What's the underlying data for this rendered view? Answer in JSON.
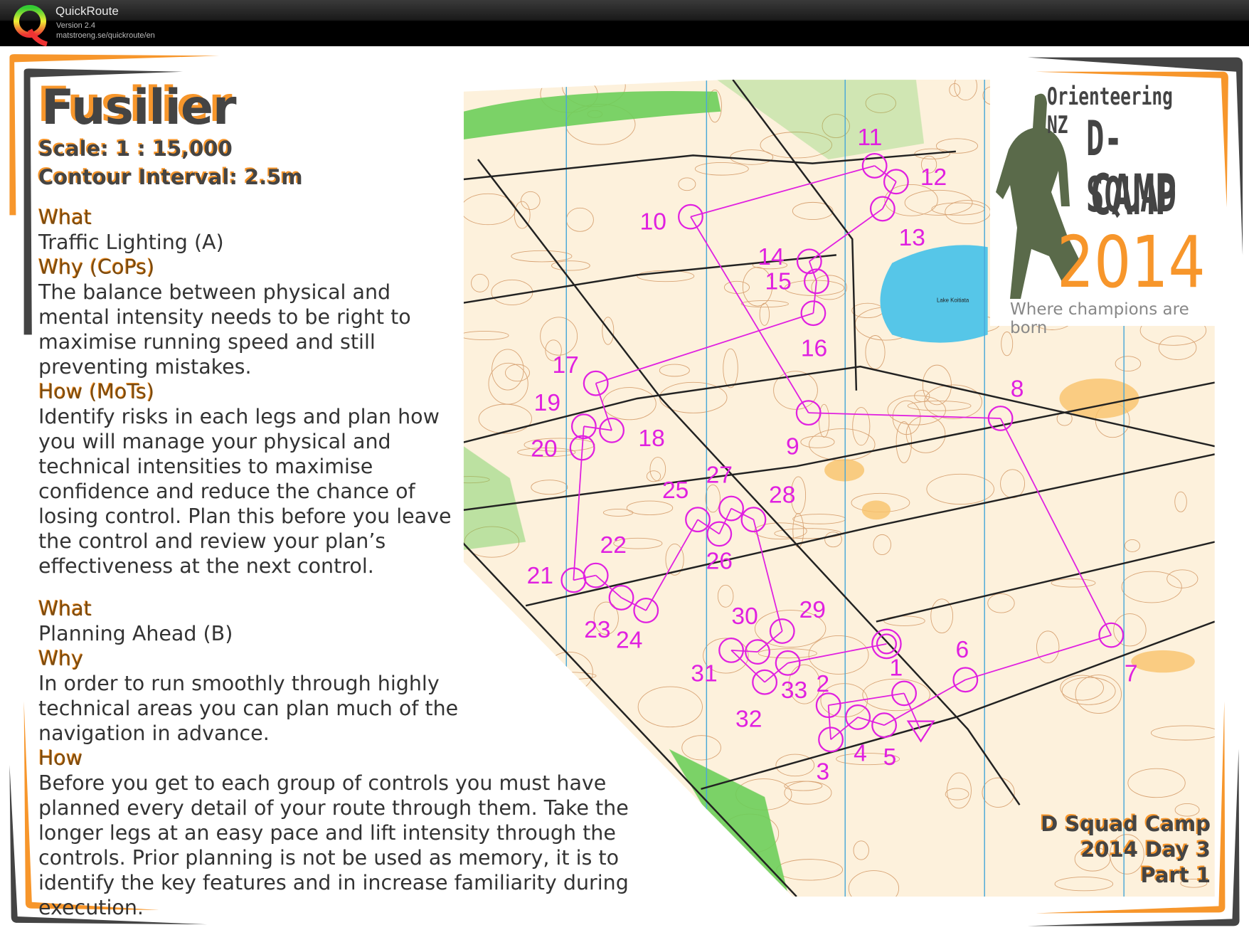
{
  "header": {
    "app_name": "QuickRoute",
    "version": "Version 2.4",
    "url": "matstroeng.se/quickroute/en"
  },
  "title": "Fusilier",
  "scale": "Scale: 1 : 15,000",
  "contour": "Contour Interval: 2.5m",
  "sections": [
    {
      "heading": "What",
      "text": "Traffic Lighting (A)"
    },
    {
      "heading": "Why (CoPs)",
      "text": "The balance between physical and mental intensity needs to be right to maximise running speed and still preventing mistakes."
    },
    {
      "heading": "How (MoTs)",
      "text": "Identify risks in each legs and plan how you will manage your physical and technical intensities to maximise confidence and reduce the chance of losing control. Plan this before you leave the control and review your plan’s effectiveness at the next control."
    },
    {
      "heading": "What",
      "text": "Planning Ahead (B)"
    },
    {
      "heading": "Why",
      "text": "In order to run smoothly through highly technical areas you can plan much of the navigation in advance."
    },
    {
      "heading": "How",
      "text": "Before you get to each group of controls you must have planned every detail of your route through them. Take the longer legs at an easy pace and lift intensity through the controls. Prior planning is not be used as memory, it is to identify the key features and in increase familiarity during execution."
    }
  ],
  "logo": {
    "line1": "Orienteering NZ",
    "line2": "D-SQUAD",
    "line3": "CAMP",
    "year": "2014",
    "tagline": "Where champions are born"
  },
  "map": {
    "lake_label": "Lake Koitiata",
    "controls": [
      "1",
      "2",
      "3",
      "4",
      "5",
      "6",
      "7",
      "8",
      "9",
      "10",
      "11",
      "12",
      "13",
      "14",
      "15",
      "16",
      "17",
      "18",
      "19",
      "20",
      "21",
      "22",
      "23",
      "24",
      "25",
      "26",
      "27",
      "28",
      "29",
      "30",
      "31",
      "32",
      "33"
    ]
  },
  "footer_note": [
    "D Squad Camp",
    "2014 Day 3",
    "Part 1"
  ],
  "colors": {
    "accent_orange": "#f7962b",
    "frame_dark": "#444444",
    "course_magenta": "#e020e0",
    "map_bg": "#fdf1dc",
    "north_lines": "#4aa8d8"
  }
}
